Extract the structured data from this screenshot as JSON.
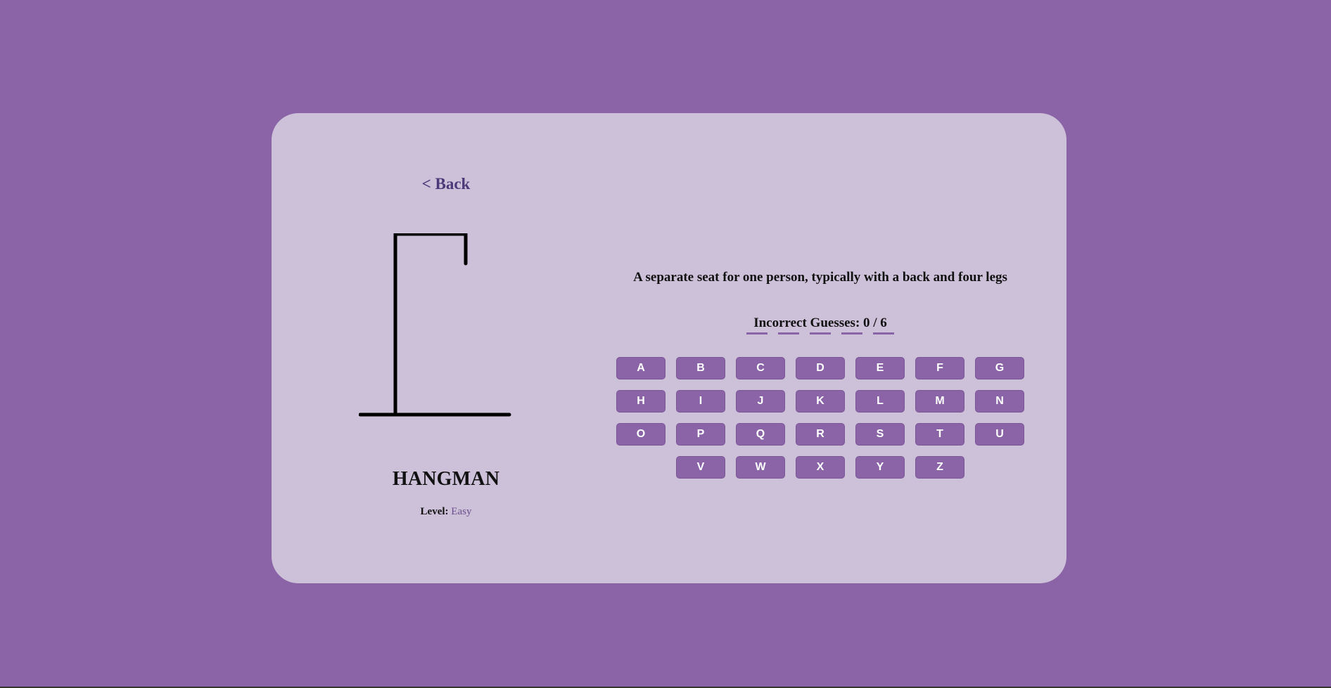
{
  "back": {
    "label": "< Back"
  },
  "game": {
    "title": "HANGMAN",
    "level_label": "Level:",
    "level_value": "Easy"
  },
  "word": {
    "length": 5,
    "revealed": [
      "",
      "",
      "",
      "",
      ""
    ]
  },
  "hint": "A separate seat for one person, typically with a back and four legs",
  "guesses": {
    "text": "Incorrect Guesses: 0 / 6",
    "incorrect": 0,
    "max": 6
  },
  "keyboard": {
    "rows": [
      [
        "A",
        "B",
        "C",
        "D",
        "E",
        "F",
        "G"
      ],
      [
        "H",
        "I",
        "J",
        "K",
        "L",
        "M",
        "N"
      ],
      [
        "O",
        "P",
        "Q",
        "R",
        "S",
        "T",
        "U"
      ],
      [
        "V",
        "W",
        "X",
        "Y",
        "Z"
      ]
    ]
  },
  "colors": {
    "background": "#8b64a7",
    "card": "#cdc0d9",
    "accent": "#8b64a7",
    "link": "#4b3a7a"
  }
}
